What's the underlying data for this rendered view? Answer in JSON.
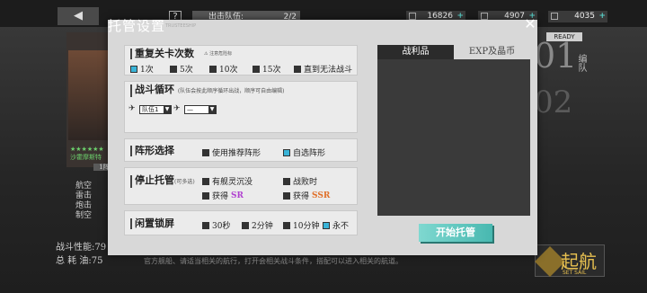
{
  "topbar": {
    "back_icon": "double-left-arrow-icon",
    "back_glyph": "◀",
    "help_glyph": "?",
    "sortie_label": "出击队伍:",
    "sortie_count": "2/2",
    "resources": [
      {
        "icon": "ammo-icon",
        "value": "16826",
        "plus": "+"
      },
      {
        "icon": "gear-icon",
        "value": "4907",
        "plus": "+"
      },
      {
        "icon": "ration-icon",
        "value": "4035",
        "plus": "+"
      }
    ]
  },
  "modal": {
    "title": "托管设置",
    "subtitle": "TRUSTEESHIP",
    "close_glyph": "✕",
    "repeat": {
      "heading": "重复关卡次数",
      "warning": "⚠ 注意危险标",
      "options": [
        {
          "label": "1次",
          "checked": true
        },
        {
          "label": "5次",
          "checked": false
        },
        {
          "label": "10次",
          "checked": false
        },
        {
          "label": "15次",
          "checked": false
        },
        {
          "label": "直到无法战斗",
          "checked": false
        }
      ]
    },
    "cycle": {
      "heading": "战斗循环",
      "note": "(队伍会按此顺序循环出战，顺序可自由编辑)",
      "slot1": "队伍1",
      "slot2": "—",
      "arrow": "▼",
      "fly_glyph": "✈"
    },
    "formation": {
      "heading": "阵形选择",
      "options": [
        {
          "label": "使用推荐阵形",
          "checked": false
        },
        {
          "label": "自选阵形",
          "checked": true
        }
      ]
    },
    "stop": {
      "heading": "停止托管",
      "note": "(可多选)",
      "options": [
        {
          "label": "有舰灵沉没",
          "checked": false
        },
        {
          "label": "战败时",
          "checked": false
        },
        {
          "label_prefix": "获得",
          "label_highlight": "SR",
          "checked": false
        },
        {
          "label_prefix": "获得",
          "label_highlight": "SSR",
          "checked": false
        }
      ]
    },
    "idle": {
      "heading": "闲置锁屏",
      "options": [
        {
          "label": "30秒",
          "checked": false
        },
        {
          "label": "2分钟",
          "checked": false
        },
        {
          "label": "10分钟",
          "checked": false
        },
        {
          "label": "永不",
          "checked": true
        }
      ]
    },
    "tabs": {
      "loot": "战利品",
      "exp": "EXP及晶币"
    },
    "start_button": "开始托管"
  },
  "background": {
    "stats_power": "战斗性能:79",
    "stats_fuel": "总 耗 油:75",
    "list": [
      "航空",
      "雷击",
      "炮击",
      "制空"
    ],
    "ready": "READY",
    "num1": "01",
    "num2": "02",
    "side_text": "编队",
    "sail_text": "起航",
    "sail_sub": "SET SAIL",
    "bottom_hint": "官方舰船、请适当相关的航行，打开会相关战斗条件，搭配可以进入相关的航道。",
    "star_text": "★★★★★★",
    "left_name": "沙霍摩斯特",
    "left_tag": "1阵"
  }
}
